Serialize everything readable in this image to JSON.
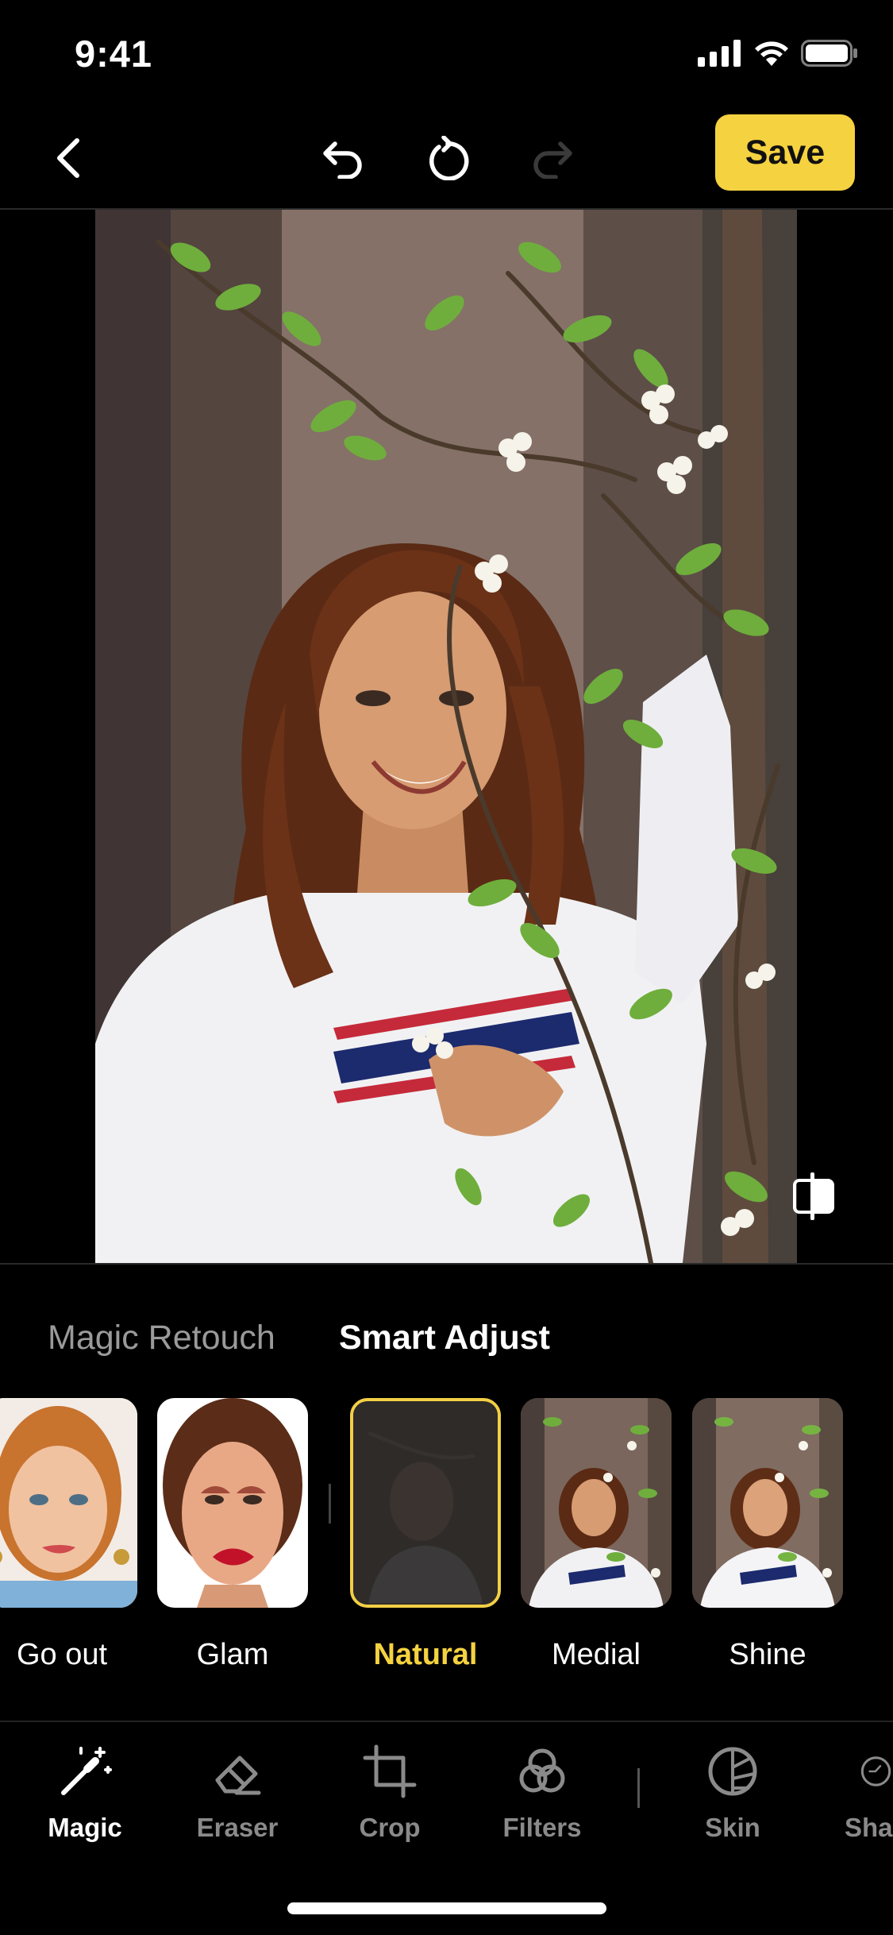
{
  "status_bar": {
    "time": "9:41",
    "icons": [
      "cellular-signal-icon",
      "wifi-icon",
      "battery-icon"
    ]
  },
  "toolbar": {
    "back_icon": "chevron-left-icon",
    "undo_icon": "undo-icon",
    "reset_icon": "rotate-reset-icon",
    "redo_icon": "redo-icon",
    "redo_enabled": false,
    "save_label": "Save"
  },
  "colors": {
    "accent": "#f5d240",
    "background": "#000000",
    "inactive_text": "#8a8a8a"
  },
  "photo": {
    "subject": "smiling woman with auburn hair among white-flowered branches",
    "compare_icon": "compare-split-icon"
  },
  "mode_tabs": [
    {
      "label": "Magic Retouch",
      "selected": false
    },
    {
      "label": "Smart Adjust",
      "selected": true
    }
  ],
  "presets": [
    {
      "label": "Go out",
      "selected": false
    },
    {
      "label": "Glam",
      "selected": false
    },
    {
      "label": "Natural",
      "selected": true
    },
    {
      "label": "Medial",
      "selected": false
    },
    {
      "label": "Shine",
      "selected": false
    }
  ],
  "tools": [
    {
      "label": "Magic",
      "icon": "magic-wand-icon",
      "selected": true
    },
    {
      "label": "Eraser",
      "icon": "eraser-icon",
      "selected": false
    },
    {
      "label": "Crop",
      "icon": "crop-icon",
      "selected": false
    },
    {
      "label": "Filters",
      "icon": "filters-icon",
      "selected": false
    },
    {
      "label": "Skin",
      "icon": "skin-icon",
      "selected": false
    },
    {
      "label": "Sha",
      "icon": "shape-icon",
      "selected": false
    }
  ]
}
